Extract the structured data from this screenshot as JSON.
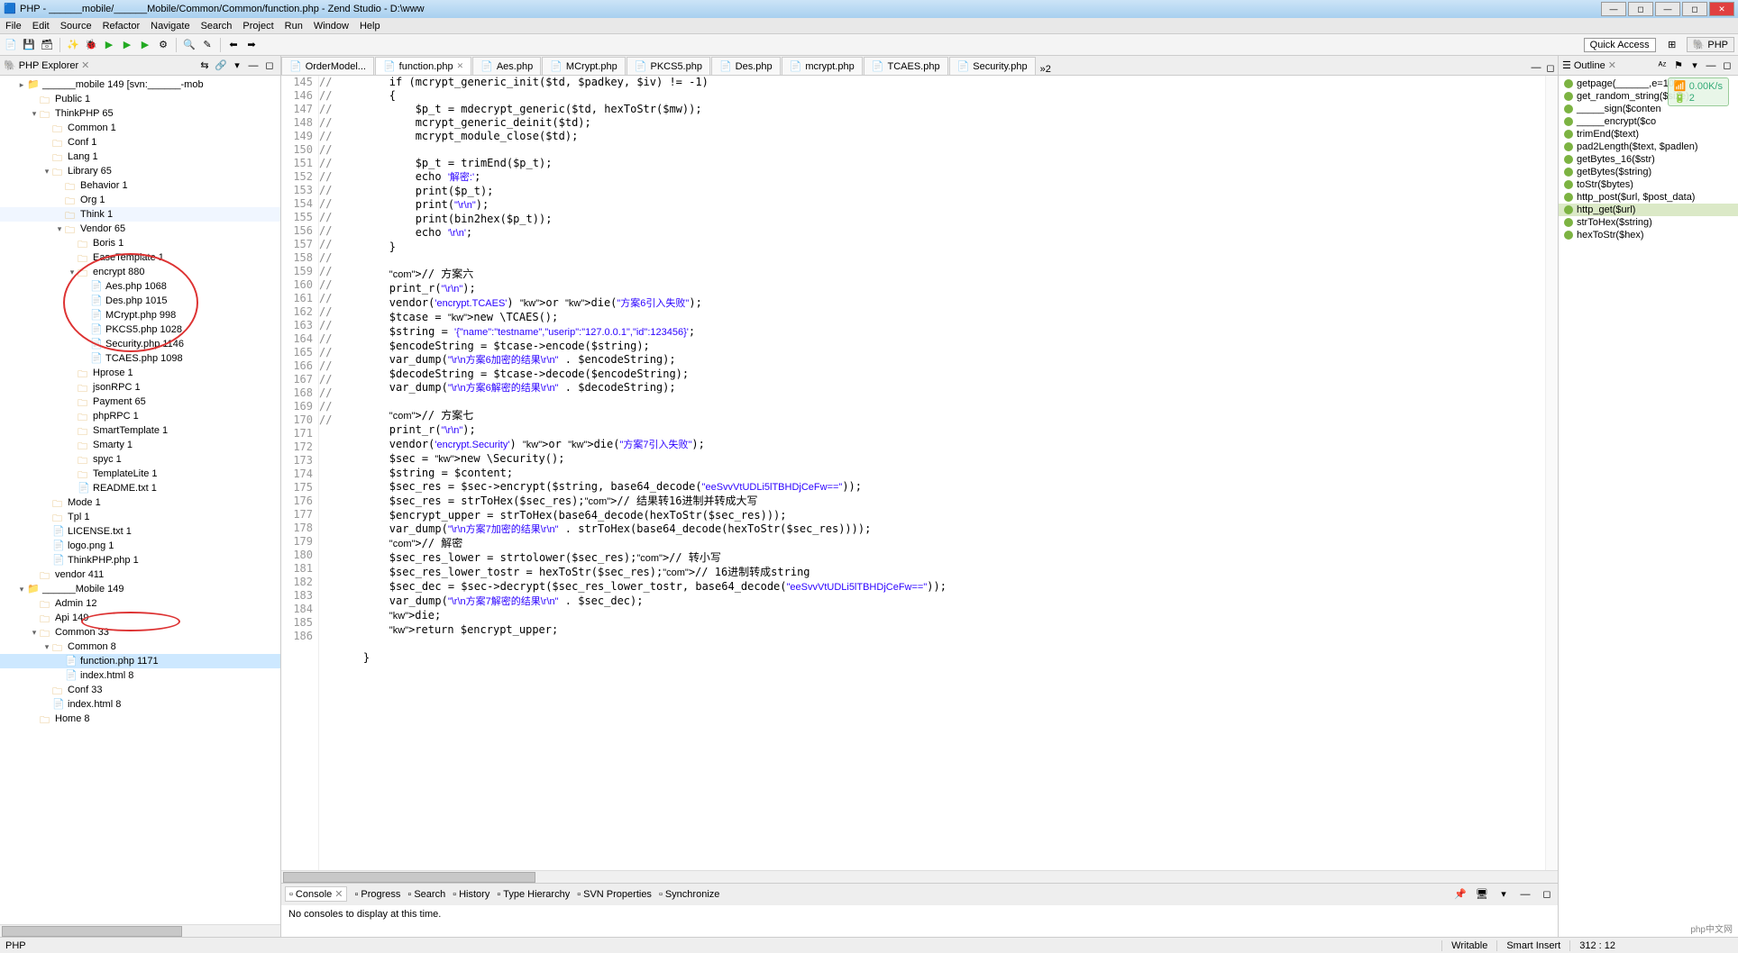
{
  "window": {
    "title": "PHP - ______mobile/______Mobile/Common/Common/function.php - Zend Studio - D:\\www"
  },
  "menu": [
    "File",
    "Edit",
    "Source",
    "Refactor",
    "Navigate",
    "Search",
    "Project",
    "Run",
    "Window",
    "Help"
  ],
  "quick_access": "Quick Access",
  "perspective": "PHP",
  "explorer": {
    "title": "PHP Explorer",
    "items": [
      {
        "d": 1,
        "t": "▸",
        "ic": "proj",
        "label": "______mobile 149 [svn:______-mob"
      },
      {
        "d": 2,
        "t": "",
        "ic": "fld",
        "label": "Public 1"
      },
      {
        "d": 2,
        "t": "▾",
        "ic": "fld",
        "label": "ThinkPHP 65"
      },
      {
        "d": 3,
        "t": "",
        "ic": "fld",
        "label": "Common 1"
      },
      {
        "d": 3,
        "t": "",
        "ic": "fld",
        "label": "Conf 1"
      },
      {
        "d": 3,
        "t": "",
        "ic": "fld",
        "label": "Lang 1"
      },
      {
        "d": 3,
        "t": "▾",
        "ic": "fld",
        "label": "Library 65"
      },
      {
        "d": 4,
        "t": "",
        "ic": "fld",
        "label": "Behavior 1"
      },
      {
        "d": 4,
        "t": "",
        "ic": "fld",
        "label": "Org 1"
      },
      {
        "d": 4,
        "t": "",
        "ic": "fld",
        "label": "Think 1",
        "hl": true
      },
      {
        "d": 4,
        "t": "▾",
        "ic": "fld",
        "label": "Vendor 65"
      },
      {
        "d": 5,
        "t": "",
        "ic": "fld",
        "label": "Boris 1"
      },
      {
        "d": 5,
        "t": "",
        "ic": "fld",
        "label": "EaseTemplate 1"
      },
      {
        "d": 5,
        "t": "▾",
        "ic": "fld",
        "label": "encrypt 880"
      },
      {
        "d": 6,
        "t": "",
        "ic": "php",
        "label": "Aes.php 1068"
      },
      {
        "d": 6,
        "t": "",
        "ic": "php",
        "label": "Des.php 1015"
      },
      {
        "d": 6,
        "t": "",
        "ic": "php",
        "label": "MCrypt.php 998"
      },
      {
        "d": 6,
        "t": "",
        "ic": "php",
        "label": "PKCS5.php 1028"
      },
      {
        "d": 6,
        "t": "",
        "ic": "php",
        "label": "Security.php 1146"
      },
      {
        "d": 6,
        "t": "",
        "ic": "php",
        "label": "TCAES.php 1098"
      },
      {
        "d": 5,
        "t": "",
        "ic": "fld",
        "label": "Hprose 1"
      },
      {
        "d": 5,
        "t": "",
        "ic": "fld",
        "label": "jsonRPC 1"
      },
      {
        "d": 5,
        "t": "",
        "ic": "fld",
        "label": "Payment 65"
      },
      {
        "d": 5,
        "t": "",
        "ic": "fld",
        "label": "phpRPC 1"
      },
      {
        "d": 5,
        "t": "",
        "ic": "fld",
        "label": "SmartTemplate 1"
      },
      {
        "d": 5,
        "t": "",
        "ic": "fld",
        "label": "Smarty 1"
      },
      {
        "d": 5,
        "t": "",
        "ic": "fld",
        "label": "spyc 1"
      },
      {
        "d": 5,
        "t": "",
        "ic": "fld",
        "label": "TemplateLite 1"
      },
      {
        "d": 5,
        "t": "",
        "ic": "file",
        "label": "README.txt 1"
      },
      {
        "d": 3,
        "t": "",
        "ic": "fld",
        "label": "Mode 1"
      },
      {
        "d": 3,
        "t": "",
        "ic": "fld",
        "label": "Tpl 1"
      },
      {
        "d": 3,
        "t": "",
        "ic": "file",
        "label": "LICENSE.txt 1"
      },
      {
        "d": 3,
        "t": "",
        "ic": "file",
        "label": "logo.png 1"
      },
      {
        "d": 3,
        "t": "",
        "ic": "php",
        "label": "ThinkPHP.php 1"
      },
      {
        "d": 2,
        "t": "",
        "ic": "fld",
        "label": "vendor 411"
      },
      {
        "d": 1,
        "t": "▾",
        "ic": "proj",
        "label": "______Mobile 149"
      },
      {
        "d": 2,
        "t": "",
        "ic": "fld",
        "label": "Admin 12"
      },
      {
        "d": 2,
        "t": "",
        "ic": "fld",
        "label": "Api 149"
      },
      {
        "d": 2,
        "t": "▾",
        "ic": "fld",
        "label": "Common 33"
      },
      {
        "d": 3,
        "t": "▾",
        "ic": "fld",
        "label": "Common 8"
      },
      {
        "d": 4,
        "t": "",
        "ic": "php",
        "label": "function.php 1171",
        "sel": true
      },
      {
        "d": 4,
        "t": "",
        "ic": "php",
        "label": "index.html 8"
      },
      {
        "d": 3,
        "t": "",
        "ic": "fld",
        "label": "Conf 33"
      },
      {
        "d": 3,
        "t": "",
        "ic": "php",
        "label": "index.html 8"
      },
      {
        "d": 2,
        "t": "",
        "ic": "fld",
        "label": "Home 8"
      }
    ]
  },
  "tabs": [
    {
      "label": "OrderModel...",
      "active": false
    },
    {
      "label": "function.php",
      "active": true
    },
    {
      "label": "Aes.php",
      "active": false
    },
    {
      "label": "MCrypt.php",
      "active": false
    },
    {
      "label": "PKCS5.php",
      "active": false
    },
    {
      "label": "Des.php",
      "active": false
    },
    {
      "label": "mcrypt.php",
      "active": false
    },
    {
      "label": "TCAES.php",
      "active": false
    },
    {
      "label": "Security.php",
      "active": false
    }
  ],
  "tabs_overflow": "»2",
  "code_start": 145,
  "code_lines": [
    {
      "c": "//",
      "t": "        if (mcrypt_generic_init($td, $padkey, $iv) != -1)"
    },
    {
      "c": "//",
      "t": "        {"
    },
    {
      "c": "//",
      "t": "            $p_t = mdecrypt_generic($td, hexToStr($mw));"
    },
    {
      "c": "//",
      "t": "            mcrypt_generic_deinit($td);"
    },
    {
      "c": "//",
      "t": "            mcrypt_module_close($td);"
    },
    {
      "c": "",
      "t": ""
    },
    {
      "c": "//",
      "t": "            $p_t = trimEnd($p_t);"
    },
    {
      "c": "//",
      "t": "            echo '解密:';"
    },
    {
      "c": "//",
      "t": "            print($p_t);"
    },
    {
      "c": "//",
      "t": "            print(\"\\r\\n\");"
    },
    {
      "c": "//",
      "t": "            print(bin2hex($p_t));"
    },
    {
      "c": "//",
      "t": "            echo '\\r\\n';"
    },
    {
      "c": "//",
      "t": "        }"
    },
    {
      "c": "",
      "t": ""
    },
    {
      "c": "",
      "t": "        // 方案六"
    },
    {
      "c": "//",
      "t": "        print_r(\"\\r\\n\");"
    },
    {
      "c": "//",
      "t": "        vendor('encrypt.TCAES') or die(\"方案6引入失败\");"
    },
    {
      "c": "//",
      "t": "        $tcase = new \\TCAES();"
    },
    {
      "c": "//",
      "t": "        $string = '{\"name\":\"testname\",\"userip\":\"127.0.0.1\",\"id\":123456}';"
    },
    {
      "c": "//",
      "t": "        $encodeString = $tcase->encode($string);"
    },
    {
      "c": "//",
      "t": "        var_dump(\"\\r\\n方案6加密的结果\\r\\n\" . $encodeString);"
    },
    {
      "c": "//",
      "t": "        $decodeString = $tcase->decode($encodeString);"
    },
    {
      "c": "//",
      "t": "        var_dump(\"\\r\\n方案6解密的结果\\r\\n\" . $decodeString);"
    },
    {
      "c": "",
      "t": ""
    },
    {
      "c": "",
      "t": "        // 方案七"
    },
    {
      "c": "",
      "t": "        print_r(\"\\r\\n\");"
    },
    {
      "c": "",
      "t": "        vendor('encrypt.Security') or die(\"方案7引入失败\");"
    },
    {
      "c": "",
      "t": "        $sec = new \\Security();"
    },
    {
      "c": "",
      "t": "        $string = $content;"
    },
    {
      "c": "",
      "t": "        $sec_res = $sec->encrypt($string, base64_decode(\"eeSvvVtUDLi5lTBHDjCeFw==\"));"
    },
    {
      "c": "",
      "t": "        $sec_res = strToHex($sec_res);// 结果转16进制并转成大写"
    },
    {
      "c": "",
      "t": "        $encrypt_upper = strToHex(base64_decode(hexToStr($sec_res)));"
    },
    {
      "c": "//",
      "t": "        var_dump(\"\\r\\n方案7加密的结果\\r\\n\" . strToHex(base64_decode(hexToStr($sec_res))));"
    },
    {
      "c": "",
      "t": "        // 解密"
    },
    {
      "c": "//",
      "t": "        $sec_res_lower = strtolower($sec_res);// 转小写"
    },
    {
      "c": "//",
      "t": "        $sec_res_lower_tostr = hexToStr($sec_res);// 16进制转成string"
    },
    {
      "c": "//",
      "t": "        $sec_dec = $sec->decrypt($sec_res_lower_tostr, base64_decode(\"eeSvvVtUDLi5lTBHDjCeFw==\"));"
    },
    {
      "c": "//",
      "t": "        var_dump(\"\\r\\n方案7解密的结果\\r\\n\" . $sec_dec);"
    },
    {
      "c": "//",
      "t": "        die;"
    },
    {
      "c": "",
      "t": "        return $encrypt_upper;",
      "ret": true
    },
    {
      "c": "",
      "t": ""
    },
    {
      "c": "",
      "t": "    }"
    }
  ],
  "bottom": {
    "tabs": [
      "Console",
      "Progress",
      "Search",
      "History",
      "Type Hierarchy",
      "SVN Properties",
      "Synchronize"
    ],
    "active": 0,
    "message": "No consoles to display at this time."
  },
  "outline": {
    "title": "Outline",
    "items": [
      {
        "label": "getpage(______,e=10)"
      },
      {
        "label": "get_random_string($size)"
      },
      {
        "label": "_____sign($conten"
      },
      {
        "label": "_____encrypt($co"
      },
      {
        "label": "trimEnd($text)"
      },
      {
        "label": "pad2Length($text, $padlen)"
      },
      {
        "label": "getBytes_16($str)"
      },
      {
        "label": "getBytes($string)"
      },
      {
        "label": "toStr($bytes)"
      },
      {
        "label": "http_post($url, $post_data)"
      },
      {
        "label": "http_get($url)",
        "sel": true
      },
      {
        "label": "strToHex($string)"
      },
      {
        "label": "hexToStr($hex)"
      }
    ]
  },
  "status": {
    "left": "PHP",
    "writable": "Writable",
    "insert": "Smart Insert",
    "pos": "312 : 12"
  },
  "overlay": {
    "speed": "0.00K/s",
    "count": "2"
  },
  "watermark": "php中文网"
}
